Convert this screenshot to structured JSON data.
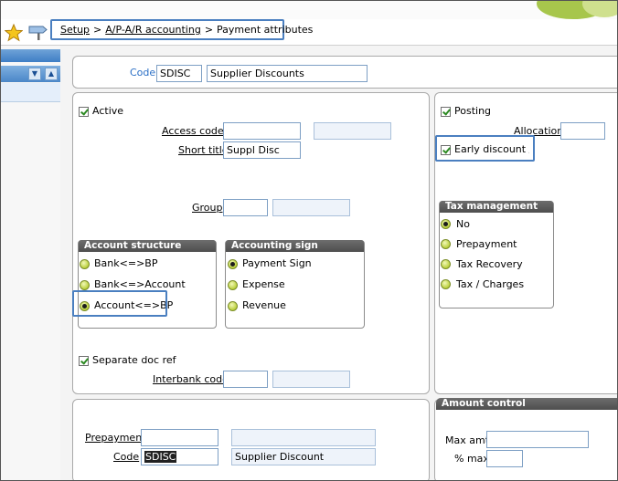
{
  "breadcrumb": {
    "items": [
      "Setup",
      "A/P-A/R accounting",
      "Payment attributes"
    ],
    "separator": ">"
  },
  "header": {
    "code_label": "Code",
    "code_value": "SDISC",
    "description_value": "Supplier Discounts"
  },
  "general": {
    "active_label": "Active",
    "access_code_label": "Access code",
    "access_code_value": "",
    "short_title_label": "Short title",
    "short_title_value": "Suppl Disc",
    "group_label": "Group",
    "group_value": "",
    "separate_doc_ref_label": "Separate doc ref",
    "interbank_code_label": "Interbank code",
    "interbank_code_value": ""
  },
  "account_structure": {
    "title": "Account structure",
    "options": [
      "Bank<=>BP",
      "Bank<=>Account",
      "Account<=>BP"
    ],
    "selected": "Account<=>BP"
  },
  "accounting_sign": {
    "title": "Accounting sign",
    "options": [
      "Payment Sign",
      "Expense",
      "Revenue"
    ],
    "selected": "Payment Sign"
  },
  "posting": {
    "posting_label": "Posting",
    "allocation_label": "Allocation",
    "allocation_value": "",
    "early_discount_label": "Early discount / la"
  },
  "tax_management": {
    "title": "Tax management",
    "options": [
      "No",
      "Prepayment",
      "Tax Recovery",
      "Tax / Charges"
    ],
    "selected": "No"
  },
  "prepayment": {
    "prepayment_label": "Prepayment",
    "prepayment_value": "",
    "code_label": "Code",
    "code_value": "SDISC",
    "description_value": "Supplier Discount"
  },
  "amount_control": {
    "title": "Amount control",
    "max_amt_label": "Max amt",
    "max_amt_value": "",
    "pct_max_label": "% max",
    "pct_max_value": ""
  },
  "colors": {
    "highlight": "#4a7fc0",
    "field_border": "#7d9fc4",
    "radio": "#b9cf3a",
    "check": "#2d8a23",
    "group_header": "#5a5a5a"
  },
  "icons": [
    "favorite-star-icon",
    "signpost-icon",
    "scroll-down-icon",
    "scroll-up-icon"
  ]
}
